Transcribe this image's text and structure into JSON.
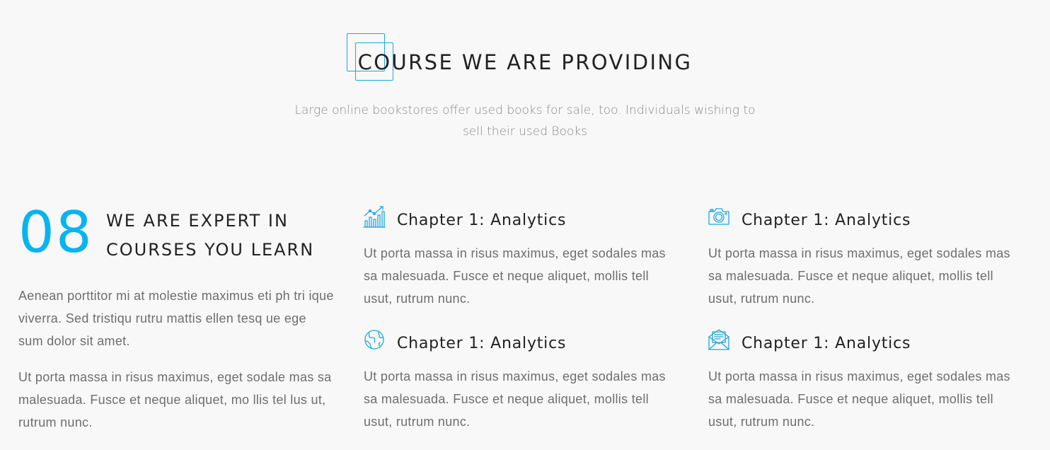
{
  "header": {
    "title": "COURSE WE ARE PROVIDING",
    "subtitle": "Large online bookstores offer used books for sale, too. Individuals wishing to sell their used Books"
  },
  "intro": {
    "number": "08",
    "title": "WE ARE EXPERT IN COURSES YOU LEARN",
    "paragraph1": "Aenean porttitor mi at molestie maximus eti ph tri ique viverra. Sed tristiqu rutru mattis ellen tesq ue ege sum dolor sit amet.",
    "paragraph2": "Ut porta massa in risus maximus, eget sodale mas sa malesuada. Fusce et neque aliquet, mo llis tel lus ut, rutrum nunc."
  },
  "features": [
    {
      "icon": "bar-chart-icon",
      "title": "Chapter 1: Analytics",
      "text": "Ut porta massa in risus maximus, eget sodales mas sa malesuada. Fusce et neque aliquet, mollis tell usut, rutrum nunc."
    },
    {
      "icon": "camera-icon",
      "title": "Chapter 1: Analytics",
      "text": "Ut porta massa in risus maximus, eget sodales mas sa malesuada. Fusce et neque aliquet, mollis tell usut, rutrum nunc."
    },
    {
      "icon": "globe-icon",
      "title": "Chapter 1: Analytics",
      "text": "Ut porta massa in risus maximus, eget sodales mas sa malesuada. Fusce et neque aliquet, mollis tell usut, rutrum nunc."
    },
    {
      "icon": "mail-open-icon",
      "title": "Chapter 1: Analytics",
      "text": "Ut porta massa in risus maximus, eget sodales mas sa malesuada. Fusce et neque aliquet, mollis tell usut, rutrum nunc."
    }
  ],
  "colors": {
    "accent": "#08b4f0",
    "background": "#f8f8f8",
    "heading": "#222222",
    "body_text": "#6e6e6e"
  }
}
